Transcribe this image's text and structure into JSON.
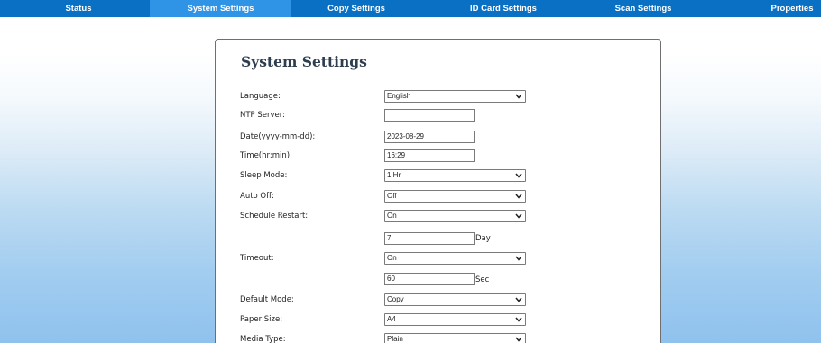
{
  "nav": {
    "tabs": [
      {
        "label": "Status"
      },
      {
        "label": "System Settings"
      },
      {
        "label": "Copy Settings"
      },
      {
        "label": "ID Card Settings"
      },
      {
        "label": "Scan Settings"
      },
      {
        "label": "Properties"
      }
    ],
    "active_tab": "System Settings"
  },
  "panel": {
    "title": "System Settings",
    "fields": {
      "language": {
        "label": "Language:",
        "value": "English"
      },
      "ntp_server": {
        "label": "NTP Server:",
        "value": ""
      },
      "date": {
        "label": "Date(yyyy-mm-dd):",
        "value": "2023-08-29"
      },
      "time": {
        "label": "Time(hr:min):",
        "value": "16:29"
      },
      "sleep_mode": {
        "label": "Sleep Mode:",
        "value": "1 Hr"
      },
      "auto_off": {
        "label": "Auto Off:",
        "value": "Off"
      },
      "schedule_restart": {
        "label": "Schedule Restart:",
        "value": "On",
        "days": "7",
        "days_unit": "Day"
      },
      "timeout": {
        "label": "Timeout:",
        "value": "On",
        "seconds": "60",
        "seconds_unit": "Sec"
      },
      "default_mode": {
        "label": "Default Mode:",
        "value": "Copy"
      },
      "paper_size": {
        "label": "Paper Size:",
        "value": "A4"
      },
      "media_type": {
        "label": "Media Type:",
        "value": "Plain"
      }
    }
  },
  "colors": {
    "navbar": "#0a70c4",
    "active_tab": "#2f93e6",
    "background_bottom": "#8fc2ee"
  }
}
